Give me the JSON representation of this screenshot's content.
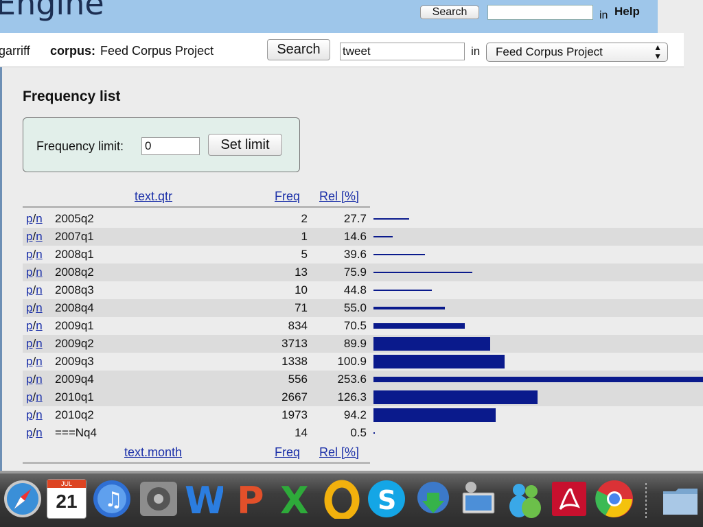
{
  "header": {
    "logo_text": "Engine",
    "search_button": "Search",
    "in_label": "in",
    "help_link": "Help"
  },
  "subheader": {
    "user": "garriff",
    "corpus_label": "corpus:",
    "corpus_name": "Feed Corpus Project",
    "search_button": "Search",
    "query_value": "tweet",
    "in_label": "in",
    "corpus_select_value": "Feed Corpus Project",
    "select_arrows": "▲\n▼"
  },
  "main": {
    "title": "Frequency list",
    "limit_label": "Frequency limit:",
    "limit_value": "0",
    "set_limit_button": "Set limit",
    "table1": {
      "col_category": "text.qtr",
      "col_freq": "Freq",
      "col_rel": "Rel [%]",
      "rows": [
        {
          "p": "p",
          "n": "n",
          "category": "2005q2",
          "freq": "2",
          "rel": "27.7"
        },
        {
          "p": "p",
          "n": "n",
          "category": "2007q1",
          "freq": "1",
          "rel": "14.6"
        },
        {
          "p": "p",
          "n": "n",
          "category": "2008q1",
          "freq": "5",
          "rel": "39.6"
        },
        {
          "p": "p",
          "n": "n",
          "category": "2008q2",
          "freq": "13",
          "rel": "75.9"
        },
        {
          "p": "p",
          "n": "n",
          "category": "2008q3",
          "freq": "10",
          "rel": "44.8"
        },
        {
          "p": "p",
          "n": "n",
          "category": "2008q4",
          "freq": "71",
          "rel": "55.0"
        },
        {
          "p": "p",
          "n": "n",
          "category": "2009q1",
          "freq": "834",
          "rel": "70.5"
        },
        {
          "p": "p",
          "n": "n",
          "category": "2009q2",
          "freq": "3713",
          "rel": "89.9"
        },
        {
          "p": "p",
          "n": "n",
          "category": "2009q3",
          "freq": "1338",
          "rel": "100.9"
        },
        {
          "p": "p",
          "n": "n",
          "category": "2009q4",
          "freq": "556",
          "rel": "253.6"
        },
        {
          "p": "p",
          "n": "n",
          "category": "2010q1",
          "freq": "2667",
          "rel": "126.3"
        },
        {
          "p": "p",
          "n": "n",
          "category": "2010q2",
          "freq": "1973",
          "rel": "94.2"
        },
        {
          "p": "p",
          "n": "n",
          "category": "===Nq4",
          "freq": "14",
          "rel": "0.5"
        }
      ]
    },
    "table2": {
      "col_category": "text.month",
      "col_freq": "Freq",
      "col_rel": "Rel [%]"
    }
  },
  "dock": {
    "calendar_month": "JUL",
    "calendar_day": "21",
    "icons": [
      "safari-icon",
      "calendar-icon",
      "itunes-icon",
      "system-preferences-icon",
      "word-icon",
      "powerpoint-icon",
      "excel-icon",
      "outlook-icon",
      "skype-icon",
      "downloader-icon",
      "remote-desktop-icon",
      "messenger-icon",
      "acrobat-icon",
      "chrome-icon",
      "folder-icon"
    ]
  },
  "colors": {
    "top_bar": "#9ec6ea",
    "link": "#1a2fa8",
    "bar": "#0a1a8c",
    "limit_box": "#e2efea"
  }
}
